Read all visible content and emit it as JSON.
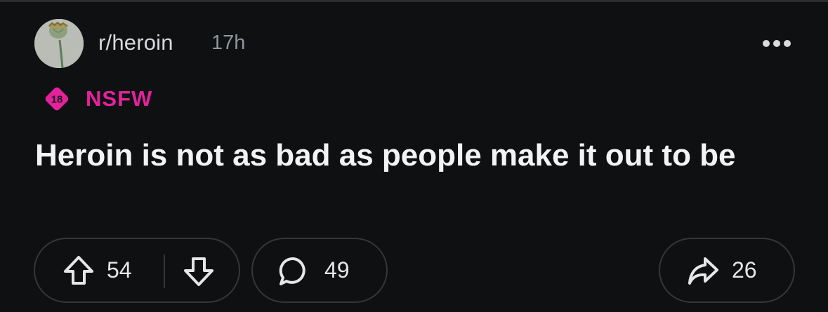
{
  "post": {
    "subreddit": "r/heroin",
    "time": "17h",
    "nsfw_badge": "18",
    "nsfw_label": "NSFW",
    "title": "Heroin is not as bad as people make it out to be",
    "upvotes": "54",
    "comments": "49",
    "shares": "26"
  },
  "icons": {
    "avatar": "poppy-pod-avatar",
    "more": "more-options-icon",
    "upvote": "arrow-up-icon",
    "downvote": "arrow-down-icon",
    "comment": "speech-bubble-icon",
    "share": "share-arrow-icon"
  },
  "colors": {
    "background": "#0f1012",
    "nsfw": "#e3229c",
    "border": "#343638"
  }
}
